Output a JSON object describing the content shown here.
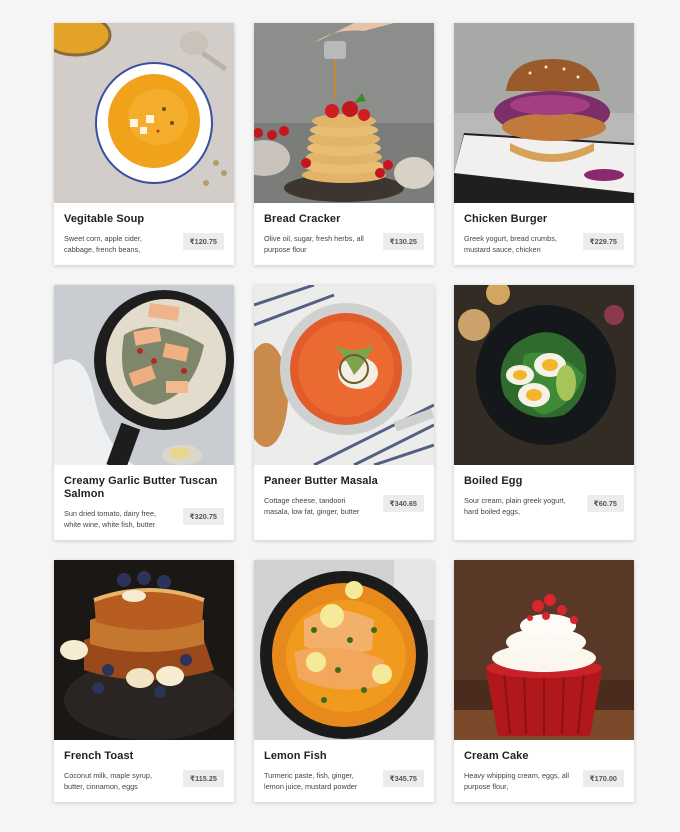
{
  "currency_symbol": "₹",
  "items": [
    {
      "title": "Vegitable Soup",
      "description": "Sweet corn, apple cider, cabbage, french beans,",
      "price": "₹120.75",
      "image_icon": "pumpkin-soup-icon"
    },
    {
      "title": "Bread Cracker",
      "description": "Olive oil, sugar, fresh herbs, all purpose flour",
      "price": "₹130.25",
      "image_icon": "pancake-stack-icon"
    },
    {
      "title": "Chicken Burger",
      "description": "Greek yogurt, bread crumbs, mustard sauce, chicken",
      "price": "₹229.75",
      "image_icon": "burger-icon"
    },
    {
      "title": "Creamy Garlic Butter Tuscan Salmon",
      "description": "Sun dried tomato, dairy free, white wine, white fish, butter",
      "price": "₹320.75",
      "image_icon": "salmon-skillet-icon"
    },
    {
      "title": "Paneer Butter Masala",
      "description": "Cottage cheese, tandoori masala, low fat, ginger, butter",
      "price": "₹340.65",
      "image_icon": "curry-bowl-icon"
    },
    {
      "title": "Boiled Egg",
      "description": "Sour cream, plain greek yogurt, hard boiled eggs,",
      "price": "₹60.75",
      "image_icon": "boiled-egg-plate-icon"
    },
    {
      "title": "French Toast",
      "description": "Coconut milk, maple syrup, butter, cinnamon, eggs",
      "price": "₹115.25",
      "image_icon": "french-toast-icon"
    },
    {
      "title": "Lemon Fish",
      "description": "Turmeric paste, fish, ginger, lemon juice, mustard powder",
      "price": "₹345.75",
      "image_icon": "lemon-fish-pan-icon"
    },
    {
      "title": "Cream Cake",
      "description": "Heavy whipping cream, eggs, all purpose flour,",
      "price": "₹170.00",
      "image_icon": "cupcake-icon"
    }
  ]
}
